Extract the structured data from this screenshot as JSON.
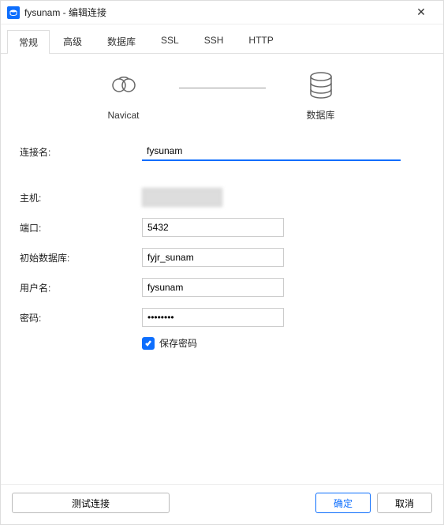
{
  "titlebar": {
    "title": "fysunam - 编辑连接"
  },
  "tabs": {
    "items": [
      "常规",
      "高级",
      "数据库",
      "SSL",
      "SSH",
      "HTTP"
    ],
    "active_index": 0
  },
  "diagram": {
    "left_label": "Navicat",
    "right_label": "数据库"
  },
  "form": {
    "connection_name": {
      "label": "连接名:",
      "value": "fysunam"
    },
    "host": {
      "label": "主机:",
      "value": ""
    },
    "port": {
      "label": "端口:",
      "value": "5432"
    },
    "initial_db": {
      "label": "初始数据库:",
      "value": "fyjr_sunam"
    },
    "username": {
      "label": "用户名:",
      "value": "fysunam"
    },
    "password": {
      "label": "密码:",
      "value": "••••••••"
    },
    "save_password": {
      "label": "保存密码",
      "checked": true
    }
  },
  "footer": {
    "test": "测试连接",
    "ok": "确定",
    "cancel": "取消"
  }
}
